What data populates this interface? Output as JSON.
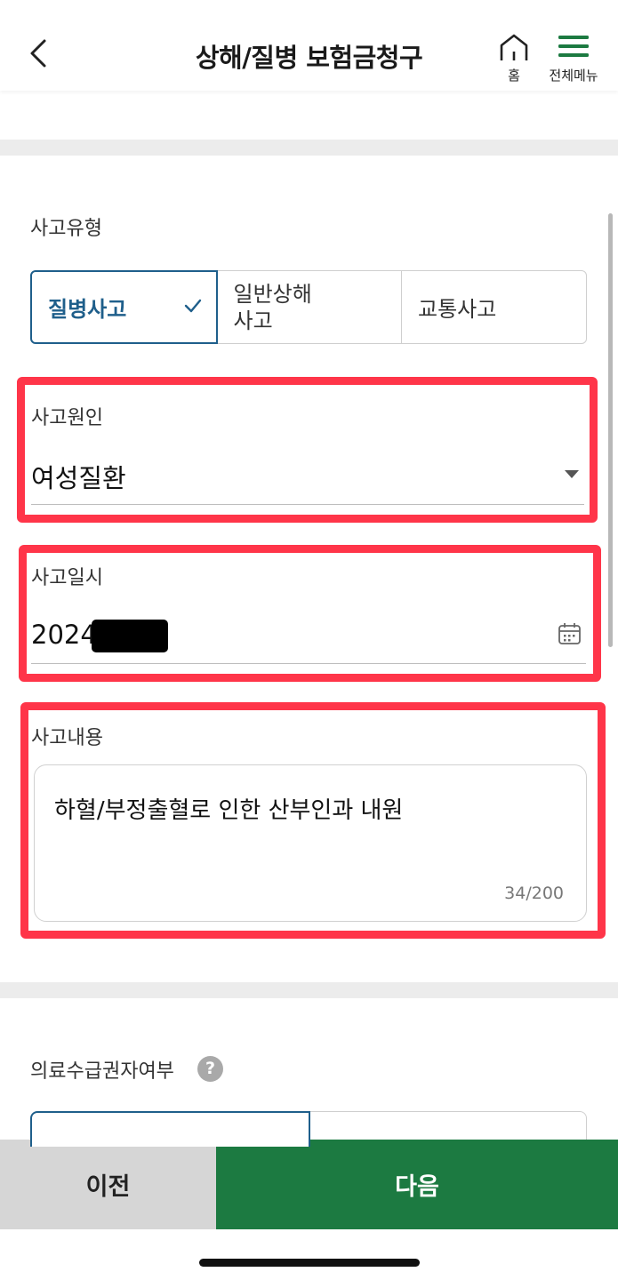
{
  "header": {
    "title": "상해/질병 보험금청구",
    "home_label": "홈",
    "menu_label": "전체메뉴"
  },
  "accident_type": {
    "label": "사고유형",
    "options": [
      "질병사고",
      "일반상해\n사고",
      "교통사고"
    ],
    "selected": "질병사고"
  },
  "cause": {
    "label": "사고원인",
    "value": "여성질환"
  },
  "date": {
    "label": "사고일시",
    "value": "2024"
  },
  "content": {
    "label": "사고내용",
    "value": "하혈/부정출혈로 인한 산부인과 내원",
    "counter": "34/200"
  },
  "medical": {
    "label": "의료수급권자여부"
  },
  "bottom": {
    "prev_label": "이전",
    "next_label": "다음"
  },
  "colors": {
    "accent": "#1f5f8b",
    "next_button": "#1c7a41",
    "highlight": "#ff3549"
  }
}
